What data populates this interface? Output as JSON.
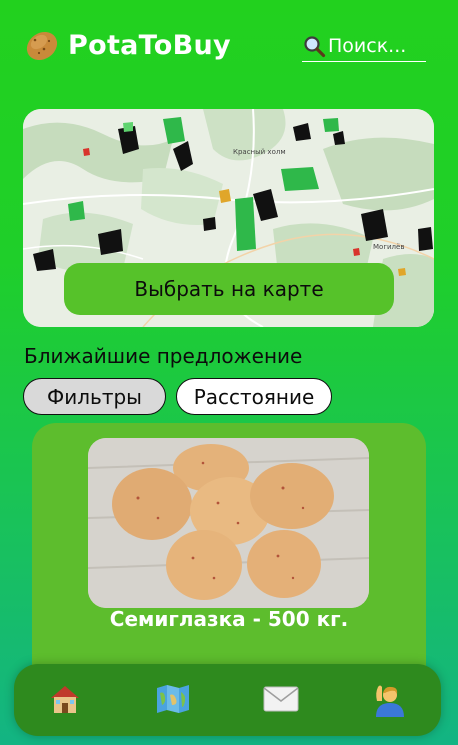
{
  "header": {
    "app_title": "PotaToBuy",
    "logo_icon": "potato-icon",
    "search": {
      "placeholder": "Поиск...",
      "icon": "magnifier-icon"
    }
  },
  "map": {
    "button_label": "Выбрать на карте",
    "place_labels": [
      "Красный холм",
      "Могилёв"
    ]
  },
  "offers_section": {
    "title": "Ближайшие предложение",
    "chips": [
      {
        "label": "Фильтры",
        "selected": true
      },
      {
        "label": "Расстояние",
        "selected": false
      }
    ]
  },
  "offer_card": {
    "title": "Семиглазка - 500 кг.",
    "image": "potatoes-photo"
  },
  "bottom_nav": {
    "items": [
      {
        "icon": "house-icon"
      },
      {
        "icon": "map-icon"
      },
      {
        "icon": "envelope-icon"
      },
      {
        "icon": "person-raising-hand-icon"
      }
    ]
  },
  "colors": {
    "background_top": "#22d11e",
    "background_bottom": "#13b483",
    "accent_green": "#56c22a",
    "card_green": "#5dbd2d",
    "nav_green": "#2e8a1e"
  }
}
